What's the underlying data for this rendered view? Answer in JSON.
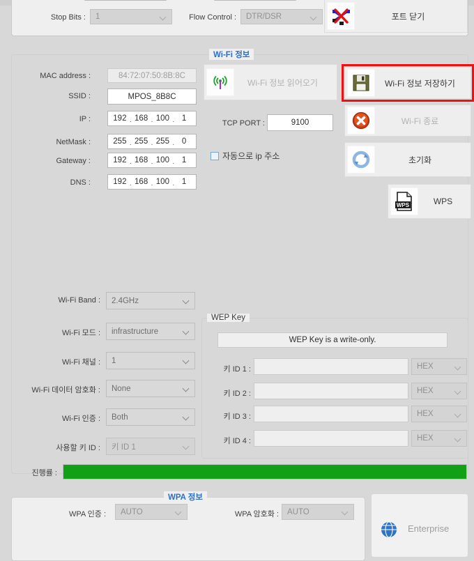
{
  "serial": {
    "stop_bits_label": "Stop Bits :",
    "stop_bits_value": "1",
    "flow_control_label": "Flow Control :",
    "flow_control_value": "DTR/DSR",
    "close_port_button": "포트 닫기",
    "close_port_icon": "port-disconnect-icon"
  },
  "wifi_group": {
    "title": "Wi-Fi 정보",
    "fields": [
      {
        "label": "MAC address :",
        "value": "84:72:07:50:8B:8C",
        "kind": "readonly-text"
      },
      {
        "label": "SSID :",
        "value": "MPOS_8B8C",
        "kind": "text"
      },
      {
        "label": "IP :",
        "octets": [
          "192",
          "168",
          "100",
          "1"
        ],
        "kind": "ip"
      },
      {
        "label": "NetMask :",
        "octets": [
          "255",
          "255",
          "255",
          "0"
        ],
        "kind": "ip"
      },
      {
        "label": "Gateway :",
        "octets": [
          "192",
          "168",
          "100",
          "1"
        ],
        "kind": "ip"
      },
      {
        "label": "DNS :",
        "octets": [
          "192",
          "168",
          "100",
          "1"
        ],
        "kind": "ip"
      }
    ],
    "tcp_port_label": "TCP PORT :",
    "tcp_port_value": "9100",
    "auto_ip_checkbox_label": "자동으로 ip 주소",
    "auto_ip_checked": false,
    "buttons": {
      "read": {
        "label": "Wi-Fi 정보 읽어오기",
        "icon": "wifi-antenna-icon",
        "disabled": true
      },
      "save": {
        "label": "Wi-Fi 정보 저장하기",
        "icon": "floppy-disk-icon",
        "disabled": false,
        "highlighted": true
      },
      "stop": {
        "label": "Wi-Fi 종료",
        "icon": "red-x-circle-icon",
        "disabled": true
      },
      "reset": {
        "label": "초기화",
        "icon": "refresh-circle-icon",
        "disabled": false
      },
      "wps": {
        "label": "WPS",
        "icon": "wps-file-icon",
        "disabled": false
      }
    }
  },
  "wifi_settings": [
    {
      "label": "Wi-Fi Band :",
      "value": "2.4GHz",
      "state": "grey"
    },
    {
      "label": "Wi-Fi 모드 :",
      "value": "infrastructure",
      "state": "grey"
    },
    {
      "label": "Wi-Fi 채널 :",
      "value": "1",
      "state": "grey"
    },
    {
      "label": "Wi-Fi 데이터 암호화 :",
      "value": "None",
      "state": "grey"
    },
    {
      "label": "Wi-Fi 인증 :",
      "value": "Both",
      "state": "grey"
    },
    {
      "label": "사용할 키 ID :",
      "value": "키 ID 1",
      "state": "disabled"
    }
  ],
  "wep_group": {
    "title": "WEP Key",
    "notice": "WEP Key is a write-only.",
    "rows": [
      {
        "label": "키 ID 1 :",
        "value": "",
        "format": "HEX"
      },
      {
        "label": "키 ID 2 :",
        "value": "",
        "format": "HEX"
      },
      {
        "label": "키 ID 3 :",
        "value": "",
        "format": "HEX"
      },
      {
        "label": "키 ID 4 :",
        "value": "",
        "format": "HEX"
      }
    ]
  },
  "progress": {
    "label": "진행률 :",
    "percent": 100,
    "color": "#11a016"
  },
  "wpa_group": {
    "title": "WPA 정보",
    "auth_label": "WPA 인증 :",
    "auth_value": "AUTO",
    "enc_label": "WPA 암호화 :",
    "enc_value": "AUTO",
    "enterprise_label": "Enterprise",
    "enterprise_icon": "globe-icon"
  },
  "colors": {
    "accent": "#2a6fc9",
    "highlight": "#ee1111",
    "progress": "#11a016",
    "window": "#efefef"
  }
}
